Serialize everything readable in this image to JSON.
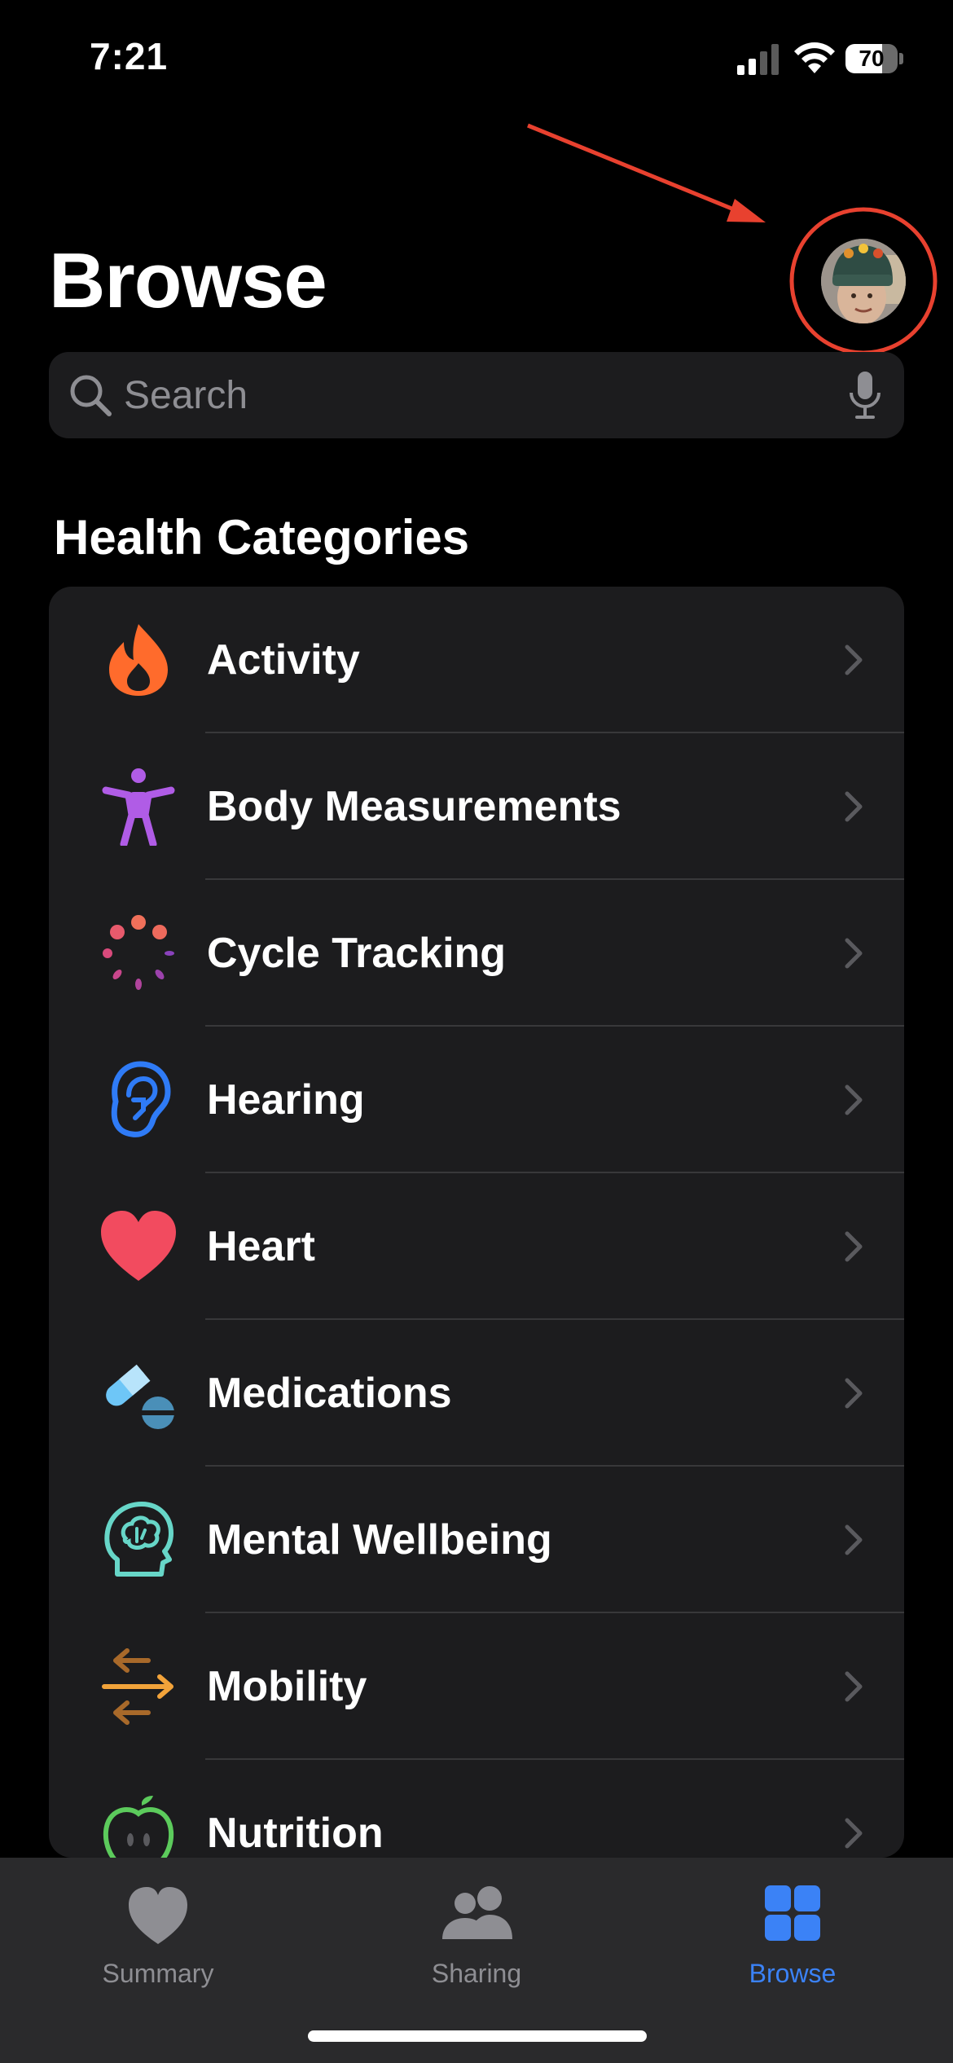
{
  "status_bar": {
    "time": "7:21",
    "battery": {
      "level_label": "70",
      "level_fraction": 0.7
    }
  },
  "header": {
    "title": "Browse",
    "avatar_icon": "profile-photo-icon"
  },
  "search": {
    "placeholder": "Search"
  },
  "categories_section": {
    "title": "Health Categories",
    "items": [
      {
        "label": "Activity",
        "icon": "flame-icon",
        "color": "#ff6b2c"
      },
      {
        "label": "Body Measurements",
        "icon": "figure-icon",
        "color": "#b05ce6"
      },
      {
        "label": "Cycle Tracking",
        "icon": "cycle-dots-icon",
        "color": "#e85a6c"
      },
      {
        "label": "Hearing",
        "icon": "ear-icon",
        "color": "#2f7bf6"
      },
      {
        "label": "Heart",
        "icon": "heart-icon",
        "color": "#f24b5f"
      },
      {
        "label": "Medications",
        "icon": "pills-icon",
        "color": "#6ec6f7"
      },
      {
        "label": "Mental Wellbeing",
        "icon": "brain-head-icon",
        "color": "#67d6c8"
      },
      {
        "label": "Mobility",
        "icon": "arrows-icon",
        "color": "#f2a33a"
      },
      {
        "label": "Nutrition",
        "icon": "apple-icon",
        "color": "#5ccb5c"
      }
    ]
  },
  "tab_bar": {
    "tabs": [
      {
        "label": "Summary",
        "icon": "heart-icon",
        "active": false
      },
      {
        "label": "Sharing",
        "icon": "people-icon",
        "active": false
      },
      {
        "label": "Browse",
        "icon": "grid-icon",
        "active": true
      }
    ]
  },
  "colors": {
    "accent": "#3b82f6",
    "annotation": "#e8412f",
    "background": "#000000",
    "card": "#1c1c1e"
  }
}
